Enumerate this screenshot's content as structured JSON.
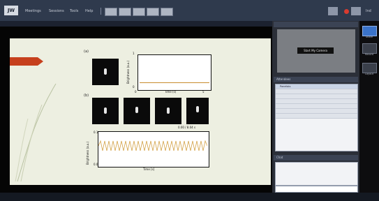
{
  "app": {
    "logo_text": "JW"
  },
  "topbar": {
    "menu": [
      "Meetings",
      "Sessions",
      "Tools",
      "Help"
    ],
    "user_label": "Ind"
  },
  "slide": {
    "panel_a_label": "(a)",
    "panel_b_label": "(b)",
    "top_plot": {
      "xlabel": "Time (s)",
      "ylabel": "Brightness (a.u.)",
      "x_start": "0",
      "x_end": "5",
      "y_start": "0",
      "y_end": "1"
    },
    "bottom_plot": {
      "xlabel": "Time [s]",
      "ylabel": "Brightness (a.u.)",
      "y_start": "0.0",
      "y_end": "0.1"
    },
    "time_stamp": "0.00 / 8.04 s"
  },
  "right_panel": {
    "video_label": "Start My Camera",
    "attendees_header": "Attendees",
    "section": "Panelists",
    "attendee_rows": [
      "",
      "",
      "",
      "",
      "",
      ""
    ],
    "chat_header": "Chat"
  },
  "side_buttons": [
    "Share",
    "Record",
    "Layout"
  ],
  "colors": {
    "accent_red": "#c6401d",
    "toolbar_bg": "#2f3a4d",
    "highlight_blue": "#3a73c9"
  }
}
